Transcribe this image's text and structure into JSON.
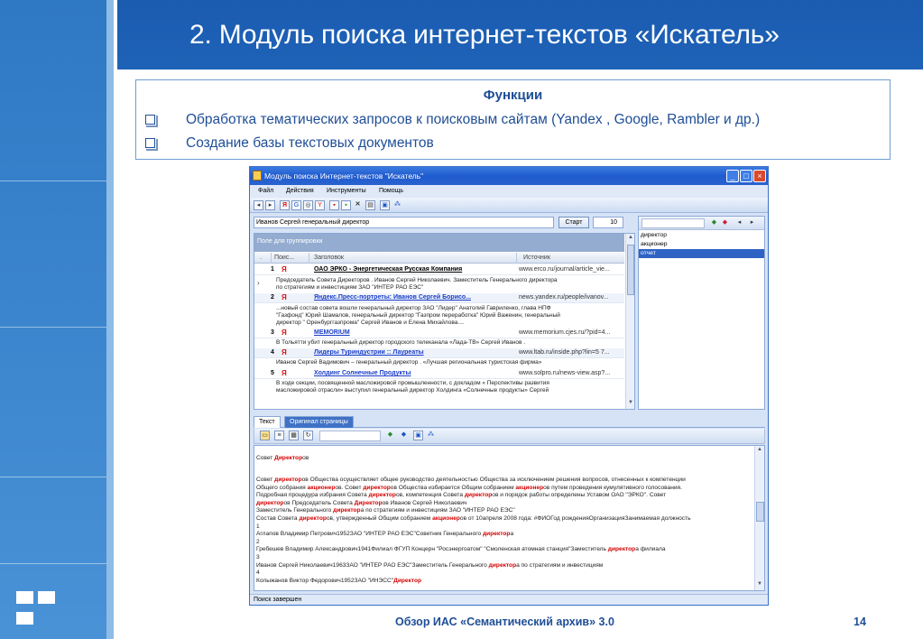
{
  "slide": {
    "title": "2. Модуль поиска интернет-текстов «Искатель»",
    "functions_title": "Функции",
    "functions": [
      "Обработка тематических запросов к поисковым сайтам (Yandex , Google, Rambler и др.)",
      "Создание базы текстовых документов"
    ],
    "footer": "Обзор ИАС «Семантический архив» 3.0",
    "page_number": "14"
  },
  "app": {
    "window_title": "Модуль поиска Интернет-текстов \"Искатель\"",
    "menu": [
      "Файл",
      "Действия",
      "Инструменты",
      "Помощь"
    ],
    "search_query": "Иванов Сергей генеральный директор",
    "start_label": "Старт",
    "result_count": "10",
    "group_panel": "Поле для группировки",
    "columns": [
      ".",
      "Поис...",
      "Заголовок",
      "Источник"
    ],
    "results": [
      {
        "num": "1",
        "title": "ОАО ЭРКО - Энергетическая Русская Компания",
        "source": "www.erco.ru/journal/article_vie...",
        "summary": [
          "Председатель Совета  Директоров . Иванов  Сергей  Николаевич. Заместитель  Генерального  директора",
          "по стратегиям и инвестициям ЗАО \"ИНТЕР РАО ЕЭС\""
        ]
      },
      {
        "num": "2",
        "title": "Яндекс.Пресс-портреты: Иванов   Сергей  Борисо...",
        "source": "news.yandex.ru/people/ivanov...",
        "summary": [
          "...новый состав совета вошли  генеральный  директор ЗАО \"Лидер\" Анатолий Гавриленко, глава НПФ",
          "\"Газфонд\" Юрий Шамалов,  генеральный   директор  \"Газпром переработка\" Юрий Важенин,  генеральный",
          "директор  \" Оренбурггазпрома\"  Сергей   Иванов  и Елена Михайлова...."
        ]
      },
      {
        "num": "3",
        "title": "MEMORIUM",
        "source": "www.memorium.cjes.ru/?pid=4...",
        "summary": [
          "В Тольятти убит  генеральный  директор  городского телеканала «Лада-ТВ»  Сергей   Иванов ."
        ]
      },
      {
        "num": "4",
        "title": "Лидеры Туриндустрии :: Лауреаты",
        "source": "www.ltab.ru/inside.php?lin=5 7...",
        "summary": [
          "Иванов   Сергей  Вадимович – генеральный   директор . «Лучшая региональная  туристская фирма»"
        ]
      },
      {
        "num": "5",
        "title": "Холдинг Солнечные Продукты",
        "source": "www.solpro.ru/news-view.asp?...",
        "summary": [
          "В ходе секции, посвященной масложировой промышленности, с докладом « Перспективы развития",
          "масложировой отрасли» выступил  генеральный   директор  Холдинга «Солнечные продукты»  Сергей"
        ]
      }
    ],
    "keywords": [
      "директор",
      "акционер",
      "отчет"
    ],
    "tabs": [
      "Текст",
      "Оригинал страницы"
    ],
    "status": "Поиск завершен",
    "doc_heading_pre": "Совет ",
    "doc_heading_red": "Директор",
    "doc_heading_post": "ов",
    "doc_lines": [
      [
        "Совет ",
        "директор",
        "ов Общества осуществляет общее руководство деятельностью Общества за исключением решения вопросов, отнесенных к компетенции"
      ],
      [
        "Общего собрания ",
        "акционер",
        "ов. Совет ",
        "директор",
        "ов Общества избирается Общим собранием ",
        "акционер",
        "ов путем проведения кумулятивного голосования."
      ],
      [
        "Подробная процедура избрания Совета ",
        "директор",
        "ов, компетенция Совета ",
        "директор",
        "ов и порядок работы определены Уставом ОАО \"ЭРКО\". Совет"
      ],
      [
        "",
        "директор",
        "ов Председатель Совета ",
        "Директор",
        "ов Иванов Сергей Николаевич"
      ],
      [
        "Заместитель Генерального ",
        "директор",
        "а по стратегиям и инвестициям ЗАО \"ИНТЕР РАО ЕЭС\""
      ],
      [
        "Состав Совета ",
        "директор",
        "ов, утвержденный Общим собранием ",
        "акционер",
        "ов от 10апреля 2008 года: #ФИОГод рожденияОрганизацияЗанимаемая должность"
      ],
      [
        "1"
      ],
      [
        "Аглапов Владимир Петрович1952ЗАО \"ИНТЕР РАО ЕЭС\"Советник Генерального ",
        "директор",
        "а"
      ],
      [
        "2"
      ],
      [
        "Гребешев Владимир Александрович1941Филиал ФГУП Концерн \"Росэнергоатом\" \"Смоленская атомная станция\"Заместитель ",
        "директор",
        "а филиала"
      ],
      [
        "3"
      ],
      [
        "Иванов Сергей Николаевич1963ЗАО \"ИНТЕР РАО ЕЭС\"Заместитель Генерального ",
        "директор",
        "а по стратегиям и инвестициям"
      ],
      [
        "4"
      ],
      [
        "Колыжанов Виктор Федорович1952ЗАО \"ИНЭСС\"",
        "Директор",
        ""
      ]
    ]
  }
}
